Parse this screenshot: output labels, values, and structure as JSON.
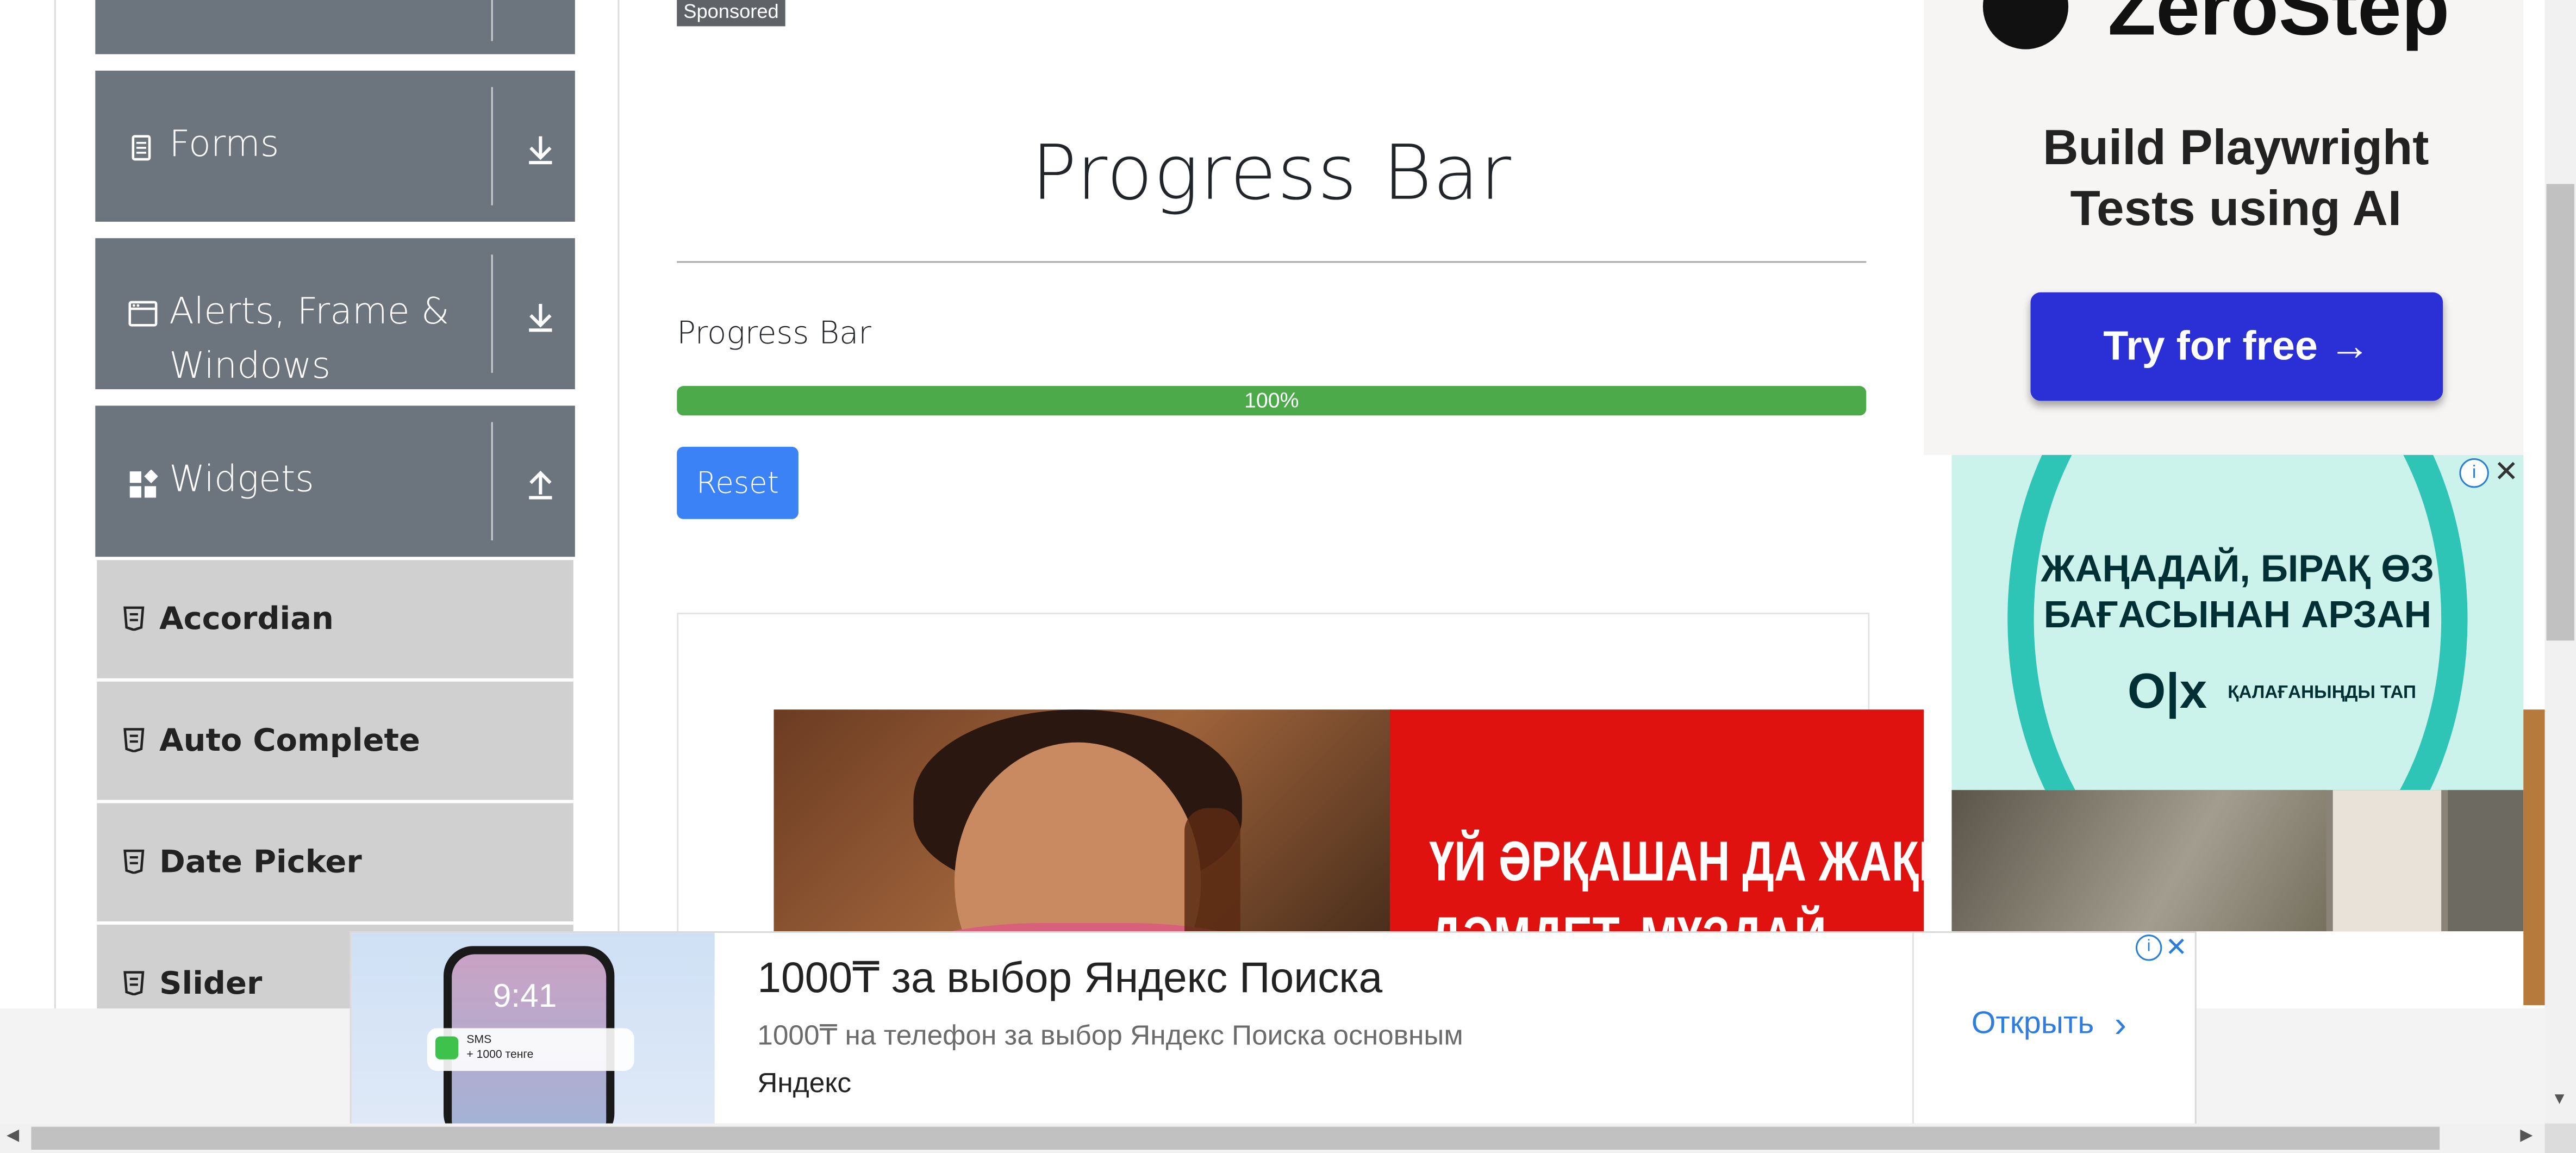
{
  "sidebar": {
    "groups": [
      {
        "label": ""
      },
      {
        "label": "Forms"
      },
      {
        "label": "Alerts, Frame &"
      },
      {
        "label": "Widgets"
      }
    ],
    "alerts_label_line2": "Windows",
    "items": [
      {
        "label": "Accordian"
      },
      {
        "label": "Auto Complete"
      },
      {
        "label": "Date Picker"
      },
      {
        "label": "Slider"
      }
    ]
  },
  "main": {
    "sponsored_label": "Sponsored",
    "page_title": "Progress Bar",
    "progress_label": "Progress Bar",
    "progress_value": 100,
    "progress_text": "100%",
    "reset_label": "Reset",
    "ad_text_line1": "ҮЙ ӘРҚАШАН ДА ЖАҚЫН",
    "ad_text_line2": "ДӘМДЕТ, МҰЗДАЙ"
  },
  "right_ads": {
    "zerostep_logo": "ZeroStep",
    "zerostep_tagline_1": "Build Playwright",
    "zerostep_tagline_2": "Tests using AI",
    "zerostep_button": "Try for free →",
    "olx_title_1": "ЖАҢАДАЙ, БІРАҚ ӨЗ",
    "olx_title_2": "БАҒАСЫНАН АРЗАН",
    "olx_logo": "O|x",
    "olx_slogan": "ҚАЛАҒАНЫҢДЫ ТАП"
  },
  "bottom_ad": {
    "phone_time": "9:41",
    "notif_title": "SMS",
    "notif_body": "+ 1000 тенге",
    "headline": "1000₸ за выбор Яндекс Поиска",
    "description": "1000₸ на телефон за выбор Яндекс Поиска основным",
    "brand": "Яндекс",
    "cta": "Открыть"
  },
  "colors": {
    "sidebar_group_bg": "#6c757d",
    "sidebar_item_bg": "#d0d0d0",
    "progress_fill": "#4caa4a",
    "reset_button": "#3b82f6",
    "zerostep_button": "#2a2fd6",
    "olx_teal": "#2ec4b6"
  }
}
